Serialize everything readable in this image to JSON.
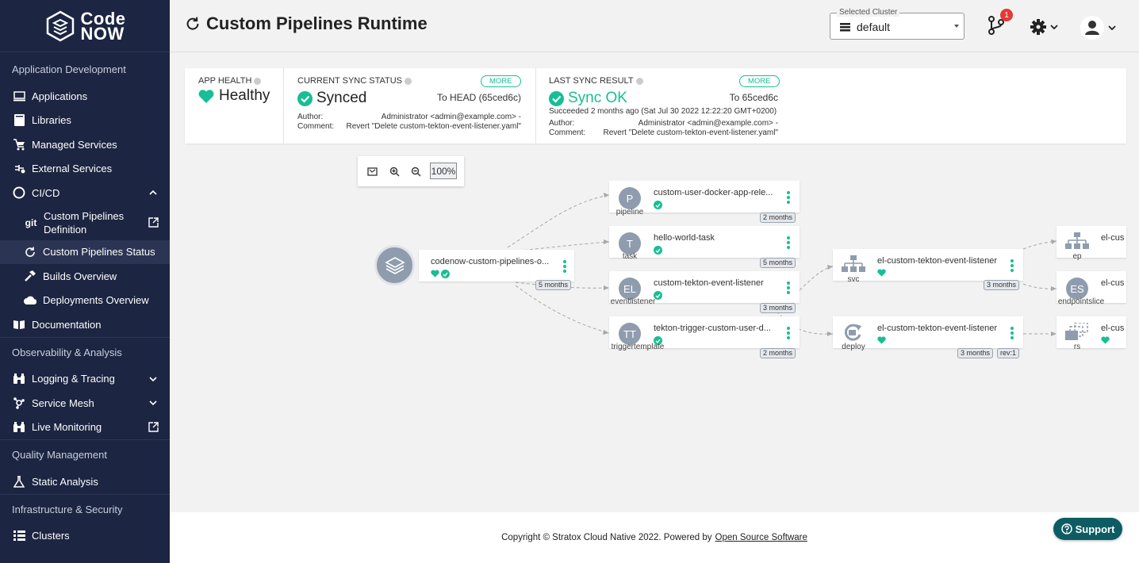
{
  "brand": {
    "line1": "Code",
    "line2": "NOW"
  },
  "sidebar": {
    "sections": [
      {
        "title": "Application Development"
      },
      {
        "title": "Observability & Analysis"
      },
      {
        "title": "Quality Management"
      },
      {
        "title": "Infrastructure & Security"
      }
    ],
    "items": {
      "applications": "Applications",
      "libraries": "Libraries",
      "managed_services": "Managed Services",
      "external_services": "External Services",
      "cicd": "CI/CD",
      "pipelines_def_line1": "Custom Pipelines",
      "pipelines_def_line2": "Definition",
      "pipelines_def_prefix": "git",
      "pipelines_status": "Custom Pipelines Status",
      "builds": "Builds Overview",
      "deployments": "Deployments Overview",
      "documentation": "Documentation",
      "logging": "Logging & Tracing",
      "service_mesh": "Service Mesh",
      "live_monitoring": "Live Monitoring",
      "static_analysis": "Static Analysis",
      "clusters": "Clusters"
    }
  },
  "header": {
    "title": "Custom Pipelines Runtime",
    "cluster_label": "Selected Cluster",
    "cluster_value": "default",
    "notifications_count": "1"
  },
  "status": {
    "health": {
      "label": "APP HEALTH",
      "value": "Healthy"
    },
    "sync": {
      "label": "CURRENT SYNC STATUS",
      "value": "Synced",
      "more": "MORE",
      "target": "To HEAD (65ced6c)",
      "author_label": "Author:",
      "author": "Administrator <admin@example.com> -",
      "comment_label": "Comment:",
      "comment": "Revert \"Delete custom-tekton-event-listener.yaml\""
    },
    "last_sync": {
      "label": "LAST SYNC RESULT",
      "value": "Sync OK",
      "more": "MORE",
      "target": "To 65ced6c",
      "when": "Succeeded 2 months ago (Sat Jul 30 2022 12:22:20 GMT+0200)",
      "author_label": "Author:",
      "author": "Administrator <admin@example.com> -",
      "comment_label": "Comment:",
      "comment": "Revert \"Delete custom-tekton-event-listener.yaml\""
    }
  },
  "zoom": {
    "value": "100%"
  },
  "graph": {
    "root": {
      "name": "codenow-custom-pipelines-o...",
      "age": "5 months"
    },
    "nodes": [
      {
        "initials": "P",
        "name": "custom-user-docker-app-rele...",
        "kind": "pipeline",
        "age": "2 months"
      },
      {
        "initials": "T",
        "name": "hello-world-task",
        "kind": "task",
        "age": "5 months"
      },
      {
        "initials": "EL",
        "name": "custom-tekton-event-listener",
        "kind": "eventlistener",
        "age": "3 months"
      },
      {
        "initials": "TT",
        "name": "tekton-trigger-custom-user-d...",
        "kind": "triggertemplate",
        "age": "2 months"
      },
      {
        "name": "el-custom-tekton-event-listener",
        "kind": "svc",
        "age": "3 months"
      },
      {
        "name": "el-custom-tekton-event-listener",
        "kind": "deploy",
        "age": "3 months",
        "rev": "rev:1"
      },
      {
        "name": "el-cus",
        "kind": "ep"
      },
      {
        "initials": "ES",
        "name": "el-cus",
        "kind": "endpointslice"
      },
      {
        "name": "el-cus",
        "kind": "rs"
      }
    ]
  },
  "footer": {
    "text": "Copyright © Stratox Cloud Native 2022. Powered by",
    "link": "Open Source Software"
  },
  "support": "Support",
  "colors": {
    "accent": "#18be94",
    "sidebar": "#1c2541",
    "support": "#0d5c63"
  }
}
